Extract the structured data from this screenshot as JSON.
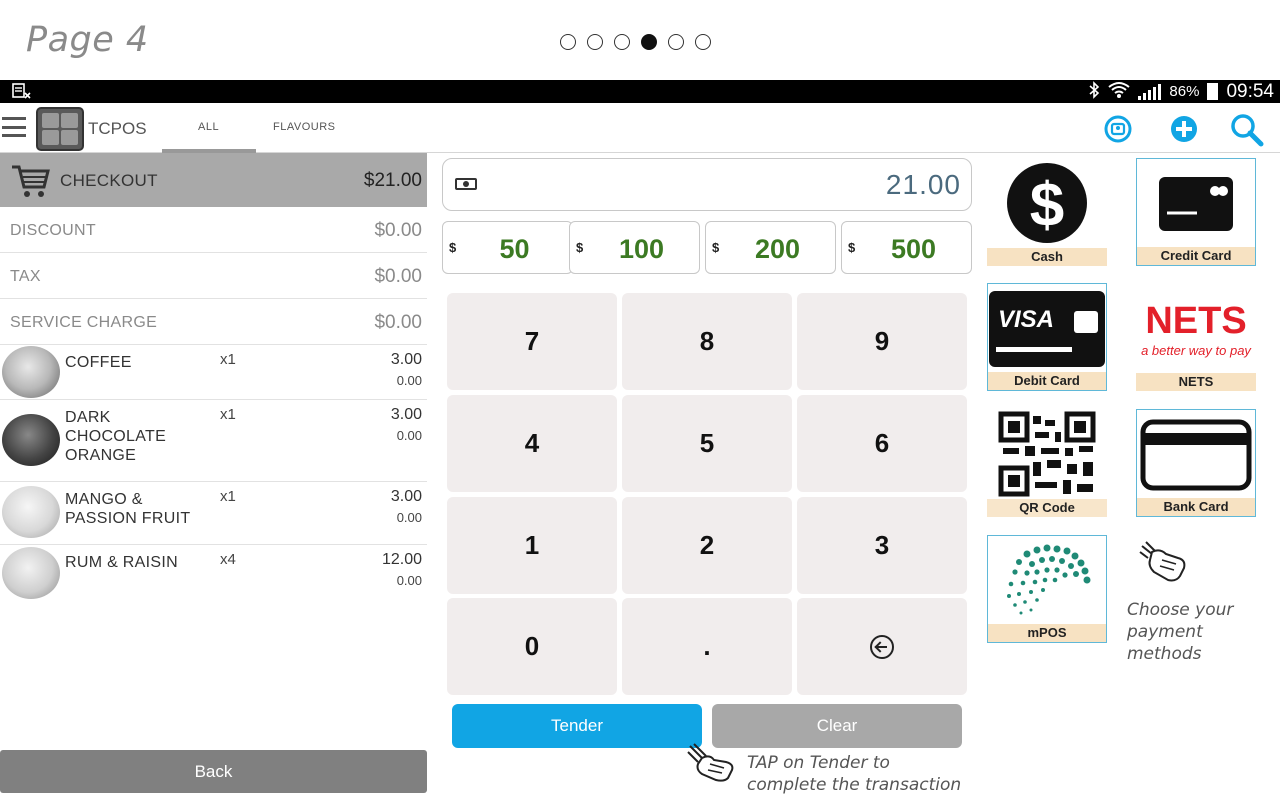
{
  "tutorial": {
    "title": "Page 4",
    "dots": 6,
    "active_dot": 4
  },
  "statusbar": {
    "battery": "86%",
    "time": "09:54"
  },
  "appbar": {
    "app_name": "TCPOS",
    "tabs": [
      {
        "label": "ALL",
        "active": true
      },
      {
        "label": "FLAVOURS",
        "active": false
      }
    ],
    "icons": [
      "user-icon",
      "add-icon",
      "search-icon"
    ],
    "accent_color": "#11a5e4"
  },
  "checkout": {
    "label": "CHECKOUT",
    "total": "$21.00"
  },
  "summary": [
    {
      "label": "DISCOUNT",
      "amount": "$0.00"
    },
    {
      "label": "TAX",
      "amount": "$0.00"
    },
    {
      "label": "SERVICE CHARGE",
      "amount": "$0.00"
    }
  ],
  "items": [
    {
      "name": "COFFEE",
      "qty": "x1",
      "price": "3.00",
      "sub": "0.00"
    },
    {
      "name": "DARK CHOCOLATE ORANGE",
      "qty": "x1",
      "price": "3.00",
      "sub": "0.00"
    },
    {
      "name": "MANGO & PASSION FRUIT",
      "qty": "x1",
      "price": "3.00",
      "sub": "0.00"
    },
    {
      "name": "RUM & RAISIN",
      "qty": "x4",
      "price": "12.00",
      "sub": "0.00"
    }
  ],
  "back_label": "Back",
  "amount": "21.00",
  "quick_amounts": [
    {
      "currency": "$",
      "value": "50"
    },
    {
      "currency": "$",
      "value": "100"
    },
    {
      "currency": "$",
      "value": "200"
    },
    {
      "currency": "$",
      "value": "500"
    }
  ],
  "keypad": [
    "7",
    "8",
    "9",
    "4",
    "5",
    "6",
    "1",
    "2",
    "3",
    "0",
    ".",
    "backspace"
  ],
  "tender_label": "Tender",
  "clear_label": "Clear",
  "tender_tip": {
    "line1": "TAP on Tender to",
    "line2": "complete the transaction"
  },
  "payment_methods": [
    {
      "label": "Cash",
      "icon": "dollar-icon"
    },
    {
      "label": "Credit Card",
      "icon": "credit-card-icon"
    },
    {
      "label": "Debit Card",
      "icon": "visa-card-icon"
    },
    {
      "label": "NETS",
      "icon": "nets-logo",
      "tagline": "a better way to pay"
    },
    {
      "label": "QR Code",
      "icon": "qr-code-icon"
    },
    {
      "label": "Bank Card",
      "icon": "bank-card-icon"
    },
    {
      "label": "mPOS",
      "icon": "mpos-dots-icon"
    }
  ],
  "payment_tip": {
    "line1": "Choose your",
    "line2": "payment methods"
  }
}
